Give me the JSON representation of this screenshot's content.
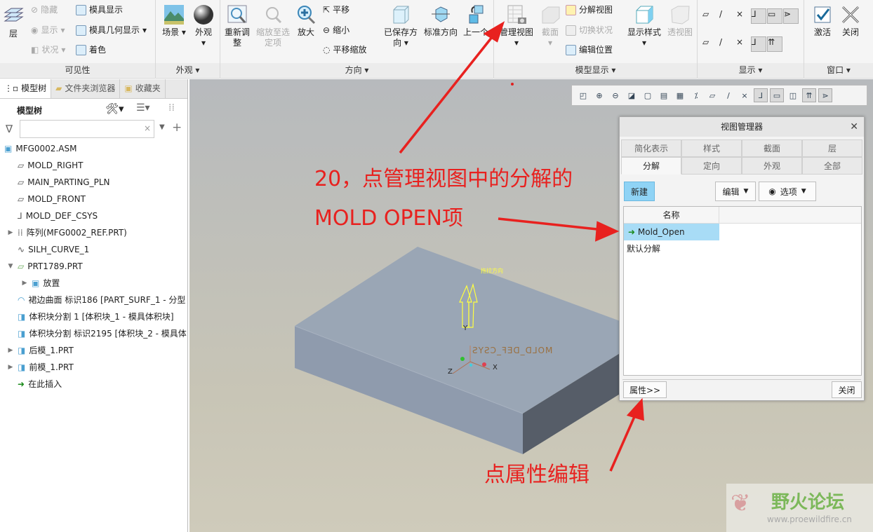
{
  "ribbon": {
    "visibility": {
      "layer": "层",
      "hide": "隐藏",
      "show": "显示",
      "status": "状况",
      "mold_display": "模具显示",
      "mold_geom_display": "模具几何显示",
      "shade": "着色",
      "label": "可见性"
    },
    "appearance": {
      "scene": "场景",
      "appearance": "外观",
      "label": "外观"
    },
    "orientation": {
      "refit": "重新调整",
      "zoom_selected": "缩放至选定项",
      "zoom_in": "放大",
      "pan": "平移",
      "zoom_out": "缩小",
      "pan_zoom": "平移缩放",
      "saved_orient": "已保存方向",
      "standard_orient": "标准方向",
      "previous": "上一个",
      "label": "方向"
    },
    "model_display": {
      "manage_views": "管理视图",
      "section": "截面",
      "explode_view": "分解视图",
      "toggle_status": "切换状况",
      "edit_position": "编辑位置",
      "display_style": "显示样式",
      "perspective": "透视图",
      "label": "模型显示"
    },
    "show": {
      "label": "显示"
    },
    "window": {
      "activate": "激活",
      "close": "关闭",
      "label": "窗口"
    }
  },
  "left_panel": {
    "tabs": [
      "模型树",
      "文件夹浏览器",
      "收藏夹"
    ],
    "title": "模型树",
    "filter_placeholder": "",
    "tree": [
      {
        "label": "MFG0002.ASM",
        "icon": "assembly-icon",
        "level": 0,
        "expand": ""
      },
      {
        "label": "MOLD_RIGHT",
        "icon": "datum-plane-icon",
        "level": 1,
        "expand": ""
      },
      {
        "label": "MAIN_PARTING_PLN",
        "icon": "datum-plane-icon",
        "level": 1,
        "expand": ""
      },
      {
        "label": "MOLD_FRONT",
        "icon": "datum-plane-icon",
        "level": 1,
        "expand": ""
      },
      {
        "label": "MOLD_DEF_CSYS",
        "icon": "csys-icon",
        "level": 1,
        "expand": ""
      },
      {
        "label": "阵列(MFG0002_REF.PRT)",
        "icon": "pattern-icon",
        "level": 1,
        "expand": "▶"
      },
      {
        "label": "SILH_CURVE_1",
        "icon": "curve-icon",
        "level": 1,
        "expand": ""
      },
      {
        "label": "PRT1789.PRT",
        "icon": "workpiece-icon",
        "level": 1,
        "expand": "▼"
      },
      {
        "label": "放置",
        "icon": "placement-icon",
        "level": 2,
        "expand": "▶"
      },
      {
        "label": "裙边曲面 标识186 [PART_SURF_1 - 分型",
        "icon": "surface-icon",
        "level": 1,
        "expand": ""
      },
      {
        "label": "体积块分割 1 [体积块_1 - 模具体积块]",
        "icon": "volume-icon",
        "level": 1,
        "expand": ""
      },
      {
        "label": "体积块分割 标识2195 [体积块_2 - 模具体",
        "icon": "volume-icon",
        "level": 1,
        "expand": ""
      },
      {
        "label": "后模_1.PRT",
        "icon": "part-icon",
        "level": 1,
        "expand": "▶"
      },
      {
        "label": "前模_1.PRT",
        "icon": "part-icon",
        "level": 1,
        "expand": "▶"
      },
      {
        "label": "在此插入",
        "icon": "insert-here-icon",
        "level": 1,
        "expand": ""
      }
    ]
  },
  "viewport": {
    "pull_direction": "拖拉方向",
    "csys_label": "MOLD_DEF_CSYS",
    "axis_x": "X",
    "axis_y": "Y",
    "axis_z": "Z"
  },
  "dialog": {
    "title": "视图管理器",
    "tabs_row1": [
      "简化表示",
      "样式",
      "截面",
      "层"
    ],
    "tabs_row2": [
      "分解",
      "定向",
      "外观",
      "全部"
    ],
    "new": "新建",
    "edit": "编辑",
    "options": "选项",
    "column": "名称",
    "items": [
      "Mold_Open",
      "默认分解"
    ],
    "properties": "属性>>",
    "close": "关闭"
  },
  "annotations": {
    "line1": "20，点管理视图中的分解的",
    "line2": "MOLD OPEN项",
    "line3": "点属性编辑"
  },
  "watermark": {
    "name": "野火论坛",
    "url": "www.proewildfire.cn"
  },
  "colors": {
    "annotation": "#e8211f",
    "selection": "#a8dcf6",
    "accent": "#8fd3f5"
  }
}
